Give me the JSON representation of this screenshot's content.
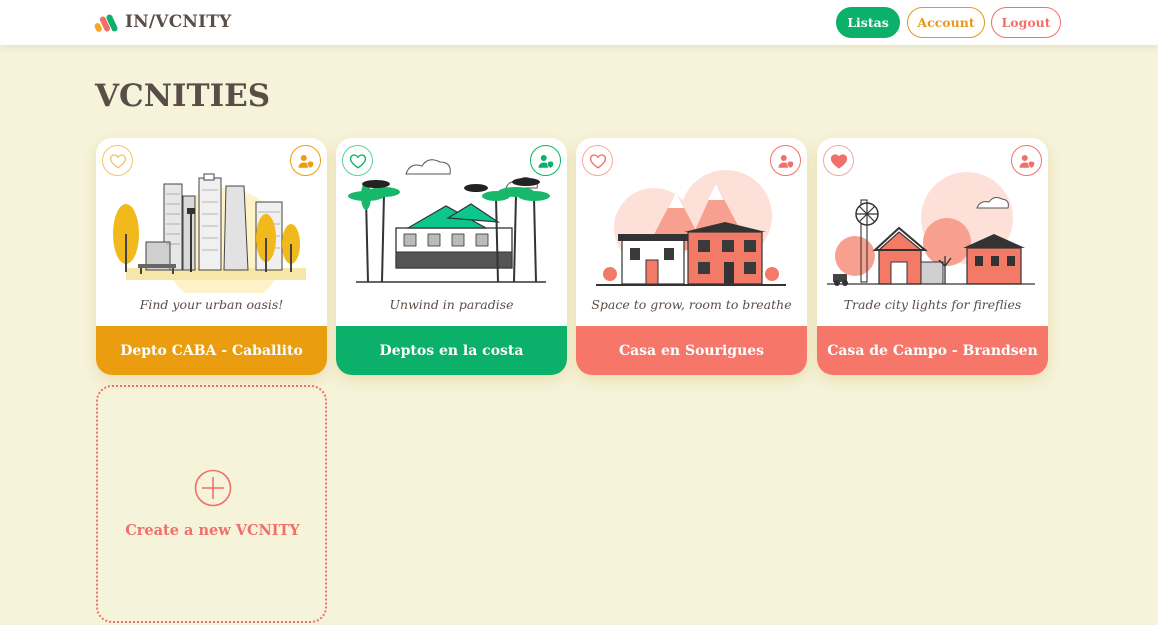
{
  "header": {
    "brand": "IN/VCNITY",
    "nav": {
      "listas": "Listas",
      "account": "Account",
      "logout": "Logout"
    }
  },
  "page": {
    "title": "VCNITIES"
  },
  "colors": {
    "green": "#0bb06a",
    "orange": "#e39a18",
    "coral": "#f0706a",
    "background": "#f6f3db",
    "text": "#5a4d46"
  },
  "cards": [
    {
      "subtitle": "Find your urban oasis!",
      "title": "Depto CABA - Caballito",
      "accent": "#e99d0f",
      "favorite": false,
      "icon": "user-shield-icon"
    },
    {
      "subtitle": "Unwind in paradise",
      "title": "Deptos en la costa",
      "accent": "#0bb06a",
      "favorite": false,
      "icon": "user-shield-icon"
    },
    {
      "subtitle": "Space to grow, room to breathe",
      "title": "Casa en Sourigues",
      "accent": "#f6776a",
      "favorite": false,
      "icon": "user-shield-icon"
    },
    {
      "subtitle": "Trade city lights for fireflies",
      "title": "Casa de Campo - Brandsen",
      "accent": "#f6776a",
      "favorite": true,
      "icon": "user-shield-icon"
    }
  ],
  "new_card": {
    "label": "Create a new VCNITY"
  }
}
